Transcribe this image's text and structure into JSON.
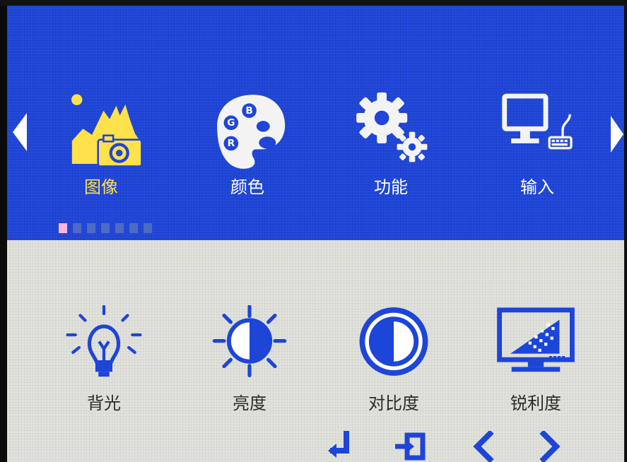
{
  "colors": {
    "top_bg": "#1f46d9",
    "bottom_bg": "#e2e2dd",
    "active_tab": "#ffe14b",
    "menu_text": "#ffffff",
    "item_text": "#2b2b2b",
    "icon_blue": "#1d45d8",
    "icon_light": "#f3f3f3",
    "indicator_active": "#ffb6e6",
    "indicator_inactive": "#4f6ac5"
  },
  "navigation": {
    "prev_icon": "arrow-left-icon",
    "next_icon": "arrow-right-icon"
  },
  "tabs": [
    {
      "id": "image",
      "label": "图像",
      "icon": "image-icon",
      "active": true
    },
    {
      "id": "color",
      "label": "颜色",
      "icon": "palette-icon",
      "active": false
    },
    {
      "id": "function",
      "label": "功能",
      "icon": "gear-icon",
      "active": false
    },
    {
      "id": "input",
      "label": "输入",
      "icon": "monitor-input-icon",
      "active": false
    }
  ],
  "palette_letters": [
    "G",
    "B",
    "R"
  ],
  "page_indicator": {
    "count": 7,
    "active_index": 0
  },
  "settings": [
    {
      "id": "backlight",
      "label": "背光",
      "icon": "lightbulb-icon"
    },
    {
      "id": "brightness",
      "label": "亮度",
      "icon": "brightness-icon"
    },
    {
      "id": "contrast",
      "label": "对比度",
      "icon": "contrast-icon"
    },
    {
      "id": "sharpness",
      "label": "锐利度",
      "icon": "sharpness-icon"
    }
  ],
  "controls": [
    {
      "id": "enter",
      "icon": "enter-icon"
    },
    {
      "id": "exit",
      "icon": "exit-icon"
    },
    {
      "id": "prev",
      "icon": "chevron-left-icon"
    },
    {
      "id": "next",
      "icon": "chevron-right-icon"
    }
  ]
}
